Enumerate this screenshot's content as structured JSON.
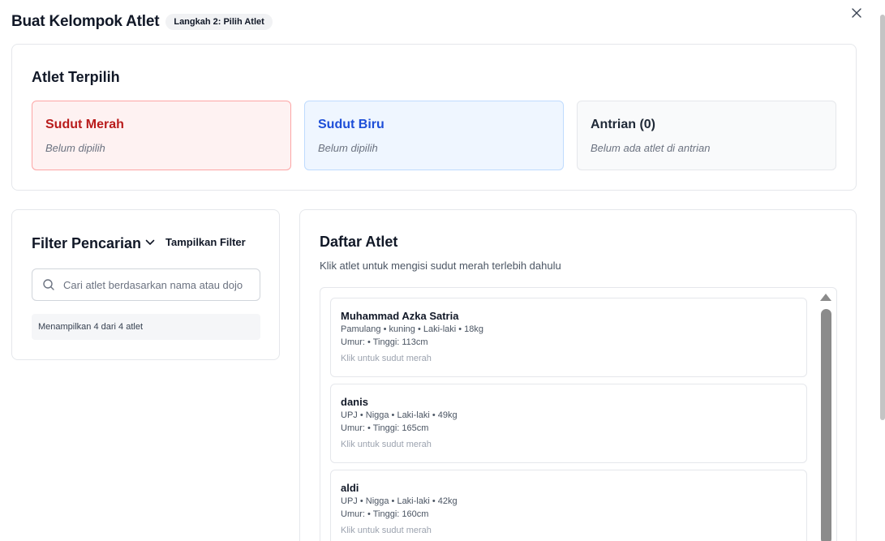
{
  "header": {
    "title": "Buat Kelompok Atlet",
    "step_badge": "Langkah 2: Pilih Atlet",
    "close_icon": "close-icon"
  },
  "selected": {
    "title": "Atlet Terpilih",
    "slots": [
      {
        "title": "Sudut Merah",
        "subtitle": "Belum dipilih",
        "color": "#b91c1c"
      },
      {
        "title": "Sudut Biru",
        "subtitle": "Belum dipilih",
        "color": "#1d4ed8"
      },
      {
        "title": "Antrian (0)",
        "subtitle": "Belum ada atlet di antrian",
        "color": "#1f2937"
      }
    ]
  },
  "filter": {
    "title": "Filter Pencarian",
    "toggle_label": "Tampilkan Filter",
    "toggle_icon": "chevron-down-icon",
    "search_placeholder": "Cari atlet berdasarkan nama atau dojo",
    "search_value": "",
    "search_icon": "search-icon",
    "count_text": "Menampilkan 4 dari 4 atlet"
  },
  "list": {
    "title": "Daftar Atlet",
    "subtitle": "Klik atlet untuk mengisi sudut merah terlebih dahulu",
    "athletes": [
      {
        "name": "Muhammad Azka Satria",
        "details": "Pamulang • kuning • Laki-laki • 18kg",
        "stats": "Umur: • Tinggi: 113cm",
        "hint": "Klik untuk sudut merah"
      },
      {
        "name": "danis",
        "details": "UPJ • Nigga • Laki-laki • 49kg",
        "stats": "Umur: • Tinggi: 165cm",
        "hint": "Klik untuk sudut merah"
      },
      {
        "name": "aldi",
        "details": "UPJ • Nigga • Laki-laki • 42kg",
        "stats": "Umur: • Tinggi: 160cm",
        "hint": "Klik untuk sudut merah"
      }
    ]
  },
  "colors": {
    "red_slot_bg": "#fef2f2",
    "blue_slot_bg": "#eff6ff",
    "border": "#e5e7eb"
  }
}
